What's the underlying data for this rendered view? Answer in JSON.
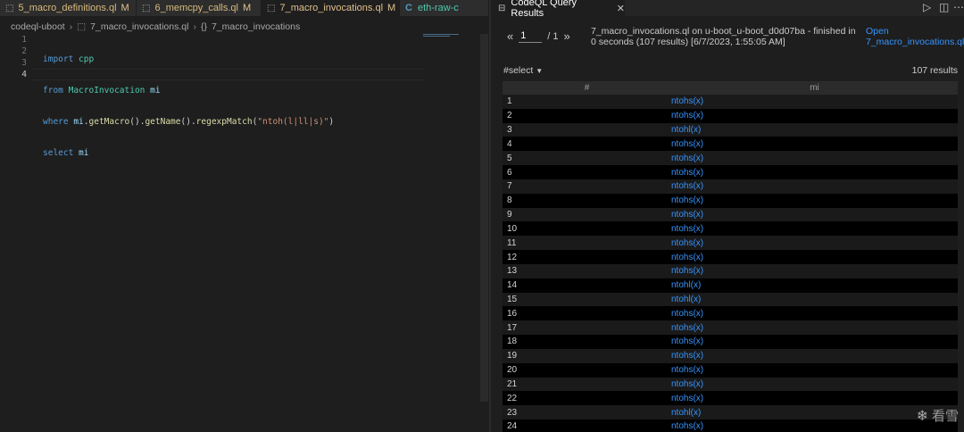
{
  "editor": {
    "tabs": [
      {
        "label": "5_macro_definitions.ql",
        "mod": "M",
        "icon": "query-file-icon"
      },
      {
        "label": "6_memcpy_calls.ql",
        "mod": "M",
        "icon": "query-file-icon"
      },
      {
        "label": "7_macro_invocations.ql",
        "mod": "M",
        "icon": "query-file-icon"
      },
      {
        "label": "eth-raw-c",
        "mod": "",
        "icon": "c-file-icon",
        "icon_glyph": "C"
      }
    ],
    "breadcrumb": {
      "root": "codeql-uboot",
      "file": "7_macro_invocations.ql",
      "symbol": "7_macro_invocations",
      "symbol_glyph": "{}"
    },
    "line_numbers": [
      "1",
      "2",
      "3",
      "4"
    ],
    "code": {
      "l1_kw": "import",
      "l1_rest": " cpp",
      "l2_kw": "from",
      "l2_type": " MacroInvocation",
      "l2_var": " mi",
      "l3_kw": "where",
      "l3_var": " mi",
      "l3_a": ".",
      "l3_fn1": "getMacro",
      "l3_b": "().",
      "l3_fn2": "getName",
      "l3_c": "().",
      "l3_fn3": "regexpMatch",
      "l3_d": "(",
      "l3_str": "\"ntoh(l|ll|s)\"",
      "l3_e": ")",
      "l4_kw": "select",
      "l4_var": " mi"
    }
  },
  "results": {
    "tab_label": "CodeQL Query Results",
    "page_current": "1",
    "page_total": "/ 1",
    "prev_glyph": "«",
    "next_glyph": "»",
    "summary": "7_macro_invocations.ql on u-boot_u-boot_d0d07ba - finished in 0 seconds (107 results) [6/7/2023, 1:55:05 AM]",
    "open_label_1": "Open",
    "open_label_2": "7_macro_invocations.ql",
    "select_label": "#select",
    "result_count": "107 results",
    "columns": [
      "#",
      "mi"
    ],
    "rows": [
      [
        "1",
        "ntohs(x)"
      ],
      [
        "2",
        "ntohs(x)"
      ],
      [
        "3",
        "ntohl(x)"
      ],
      [
        "4",
        "ntohs(x)"
      ],
      [
        "5",
        "ntohs(x)"
      ],
      [
        "6",
        "ntohs(x)"
      ],
      [
        "7",
        "ntohs(x)"
      ],
      [
        "8",
        "ntohs(x)"
      ],
      [
        "9",
        "ntohs(x)"
      ],
      [
        "10",
        "ntohs(x)"
      ],
      [
        "11",
        "ntohs(x)"
      ],
      [
        "12",
        "ntohs(x)"
      ],
      [
        "13",
        "ntohs(x)"
      ],
      [
        "14",
        "ntohl(x)"
      ],
      [
        "15",
        "ntohl(x)"
      ],
      [
        "16",
        "ntohs(x)"
      ],
      [
        "17",
        "ntohs(x)"
      ],
      [
        "18",
        "ntohs(x)"
      ],
      [
        "19",
        "ntohs(x)"
      ],
      [
        "20",
        "ntohs(x)"
      ],
      [
        "21",
        "ntohs(x)"
      ],
      [
        "22",
        "ntohs(x)"
      ],
      [
        "23",
        "ntohl(x)"
      ],
      [
        "24",
        "ntohs(x)"
      ]
    ]
  },
  "watermark": {
    "text": "看雪",
    "icon": "snowflake-icon"
  },
  "colors": {
    "accent_link": "#3794ff",
    "modified": "#e2c08d",
    "keyword": "#569cd6",
    "type": "#4ec9b0",
    "string": "#ce9178"
  }
}
